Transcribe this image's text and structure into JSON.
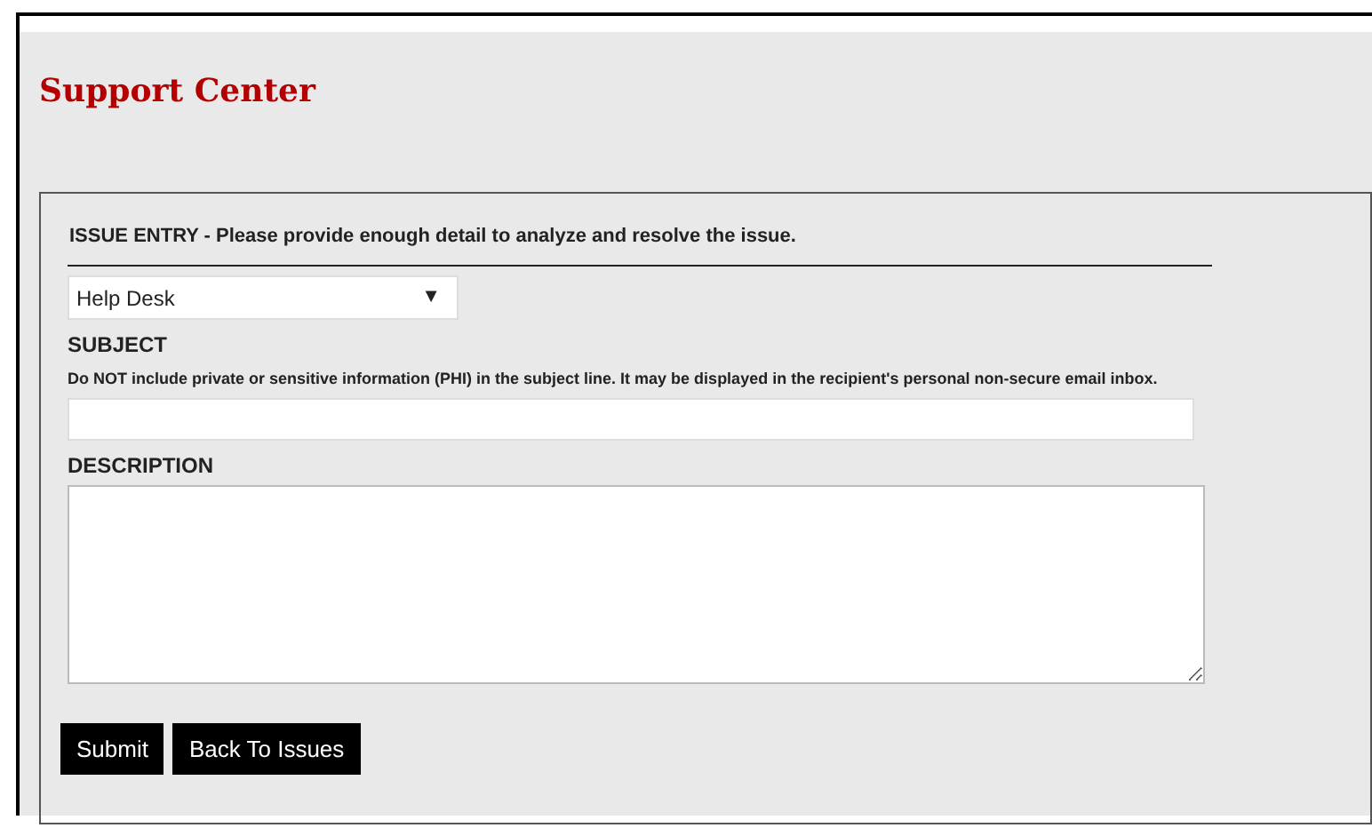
{
  "page_title": "Support Center",
  "form": {
    "heading": "ISSUE ENTRY - Please provide enough detail to analyze and resolve the issue.",
    "category": {
      "value": "Help Desk",
      "arrow": "▼"
    },
    "subject": {
      "label": "SUBJECT",
      "note": "Do NOT include private or sensitive information (PHI) in the subject line. It may be displayed in the recipient's personal non-secure email inbox."
    },
    "description": {
      "label": "DESCRIPTION"
    },
    "buttons": [
      "Submit",
      "Back To Issues"
    ]
  }
}
